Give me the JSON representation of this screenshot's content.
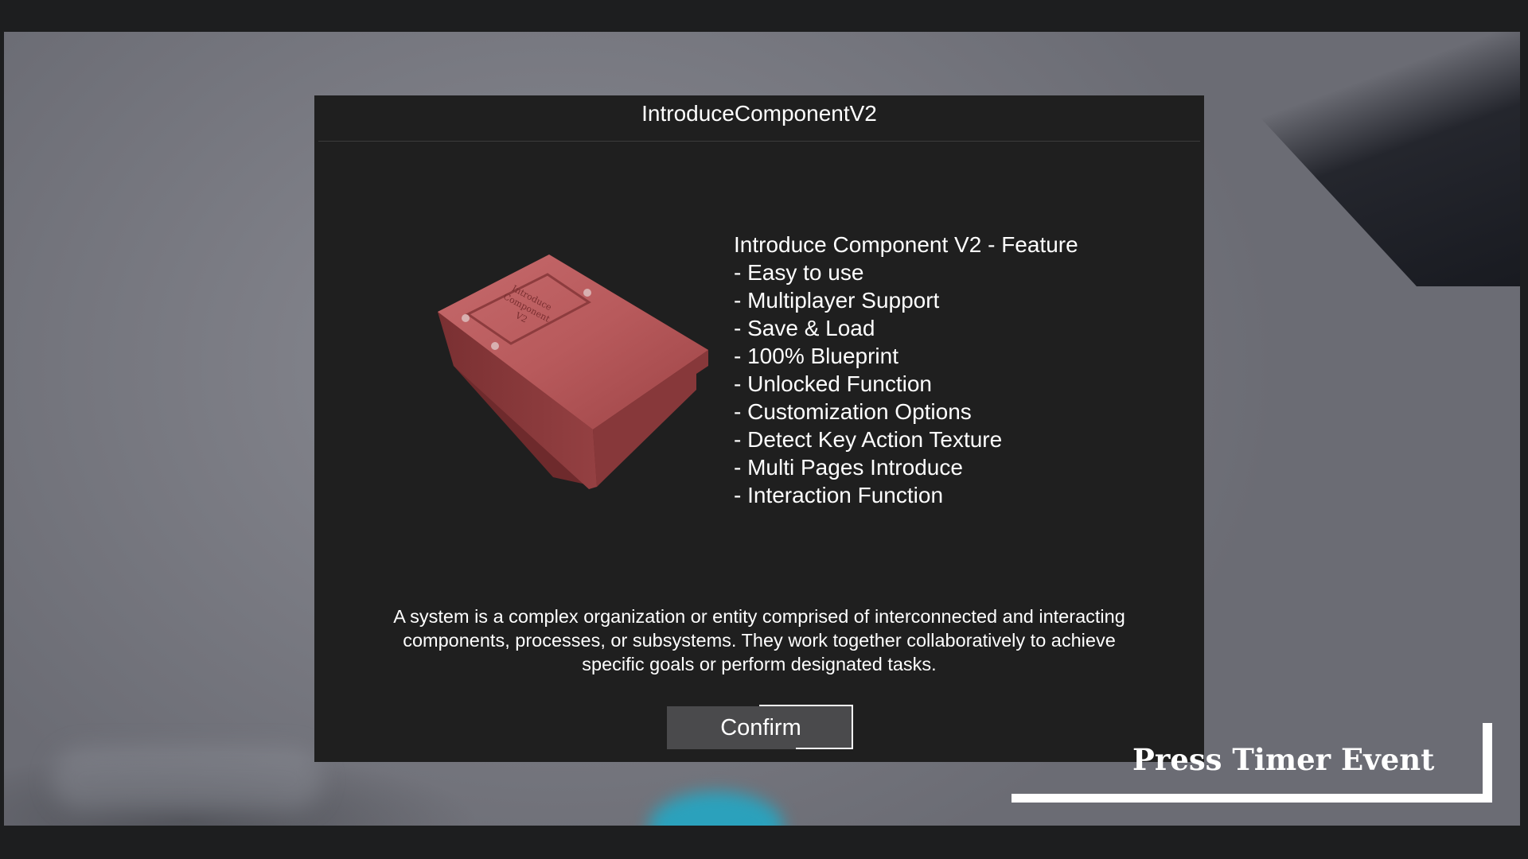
{
  "dialog": {
    "title": "IntroduceComponentV2",
    "book_cover_text": [
      "Introduce",
      "Component",
      "V2"
    ],
    "features": [
      "Introduce Component V2 - Feature",
      "- Easy to use",
      "- Multiplayer Support",
      "- Save & Load",
      "- 100% Blueprint",
      "- Unlocked Function",
      "- Customization Options",
      "- Detect Key Action Texture",
      "- Multi Pages Introduce",
      "- Interaction Function"
    ],
    "description": "A system is a complex organization or entity comprised of interconnected and interacting components, processes, or subsystems. They work together collaboratively to achieve specific goals or perform designated tasks.",
    "confirm_label": "Confirm"
  },
  "hud": {
    "timer_label": "Press Timer Event"
  },
  "colors": {
    "dialog_bg": "#1f1f1f",
    "button_bg": "#4a4a4c",
    "text": "#ffffff",
    "book_red": "#b85a5c",
    "glow_blue": "#1faac8"
  }
}
